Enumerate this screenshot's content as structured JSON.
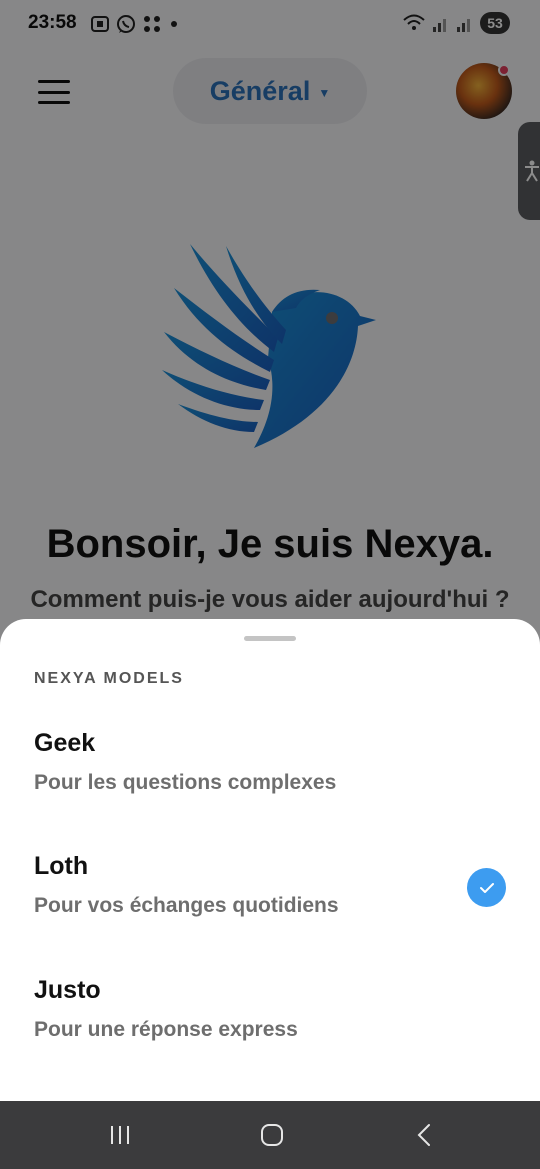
{
  "status_bar": {
    "time": "23:58",
    "battery": "53",
    "left_icons": [
      "screenshot-icon",
      "whatsapp-icon",
      "apps-icon",
      "dot-icon"
    ],
    "right_icons": [
      "wifi-icon",
      "signal-icon",
      "signal-icon"
    ]
  },
  "header": {
    "model_selector_label": "Général",
    "accent_color": "#2b6fb6"
  },
  "home": {
    "greeting": "Bonsoir, Je suis Nexya.",
    "subtitle": "Comment puis-je vous aider aujourd'hui ?"
  },
  "sheet": {
    "title": "NEXYA MODELS",
    "options": [
      {
        "name": "Geek",
        "description": "Pour les questions complexes",
        "selected": false
      },
      {
        "name": "Loth",
        "description": "Pour vos échanges quotidiens",
        "selected": true
      },
      {
        "name": "Justo",
        "description": "Pour une réponse express",
        "selected": false
      }
    ],
    "selected_color": "#3d9cf0"
  },
  "nav_bar": {
    "buttons": [
      "recent-apps-icon",
      "home-icon",
      "back-icon"
    ]
  }
}
